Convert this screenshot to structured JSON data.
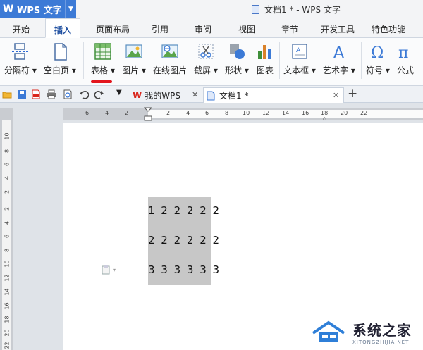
{
  "app": {
    "name": "WPS 文字",
    "logo": "W",
    "window_title": "文档1 * - WPS 文字"
  },
  "menu": {
    "tabs": [
      "开始",
      "插入",
      "页面布局",
      "引用",
      "审阅",
      "视图",
      "章节",
      "开发工具",
      "特色功能"
    ],
    "active": "插入"
  },
  "ribbon": {
    "page_break": "分隔符",
    "blank_page": "空白页",
    "table": "表格",
    "picture": "图片",
    "online_picture": "在线图片",
    "screenshot": "截屏",
    "shape": "形状",
    "chart": "图表",
    "text_box": "文本框",
    "word_art": "艺术字",
    "symbol": "符号",
    "formula": "公式"
  },
  "doctabs": {
    "home": "我的WPS",
    "doc": "文档1 *",
    "add": "+"
  },
  "ruler": {
    "h_ticks": [
      "6",
      "4",
      "2",
      "2",
      "4",
      "6",
      "8",
      "10",
      "12",
      "14",
      "16",
      "18",
      "20",
      "22"
    ],
    "v_ticks": [
      "10",
      "8",
      "6",
      "4",
      "2",
      "2",
      "4",
      "6",
      "8",
      "10",
      "12",
      "14",
      "16",
      "18",
      "20",
      "22",
      "24"
    ]
  },
  "document": {
    "rows": [
      "1 2 2 2 2 2",
      "2 2 2 2 2 2",
      "3 3 3 3 3 3"
    ]
  },
  "watermark": {
    "cn": "系统之家",
    "en": "XITONGZHIJIA.NET"
  },
  "colors": {
    "accent": "#3c7ad6",
    "underline": "#e3161d",
    "selection": "#c7c7c7"
  }
}
